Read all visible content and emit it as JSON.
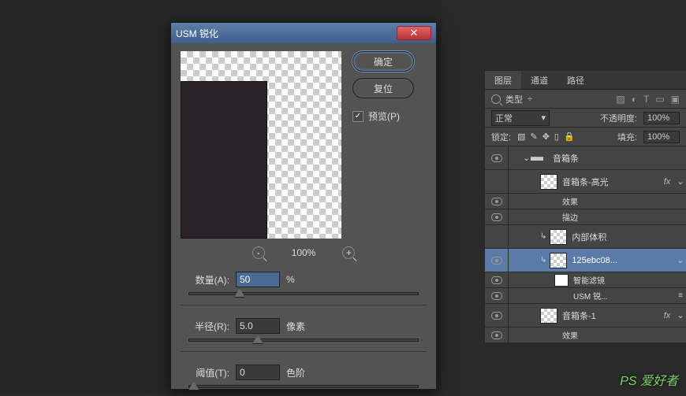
{
  "dialog": {
    "title": "USM 锐化",
    "ok": "确定",
    "reset": "复位",
    "preview": "预览(P)",
    "preview_checked": "✓",
    "zoom_pct": "100%",
    "amount_label": "数量(A):",
    "amount_value": "50",
    "amount_unit": "%",
    "radius_label": "半径(R):",
    "radius_value": "5.0",
    "radius_unit": "像素",
    "threshold_label": "阈值(T):",
    "threshold_value": "0",
    "threshold_unit": "色阶"
  },
  "panels": {
    "tabs": {
      "layers": "图层",
      "channels": "通道",
      "paths": "路径"
    },
    "filter_label": "类型",
    "blend_mode": "正常",
    "opacity_label": "不透明度:",
    "opacity_value": "100%",
    "lock_label": "锁定:",
    "fill_label": "填充:",
    "fill_value": "100%",
    "layers": {
      "group": "音箱条",
      "l1": "音箱条-高光",
      "l1a": "效果",
      "l1b": "描边",
      "l2": "内部体积",
      "l3": "125ebc08...",
      "l3a": "智能滤镜",
      "l3b": "USM 锐...",
      "l4": "音箱条-1",
      "l4a": "效果"
    },
    "fx": "fx",
    "chevron": "⌄",
    "chevron_right": "›",
    "eq_icon": "≡"
  },
  "watermark": "PS 爱好者"
}
